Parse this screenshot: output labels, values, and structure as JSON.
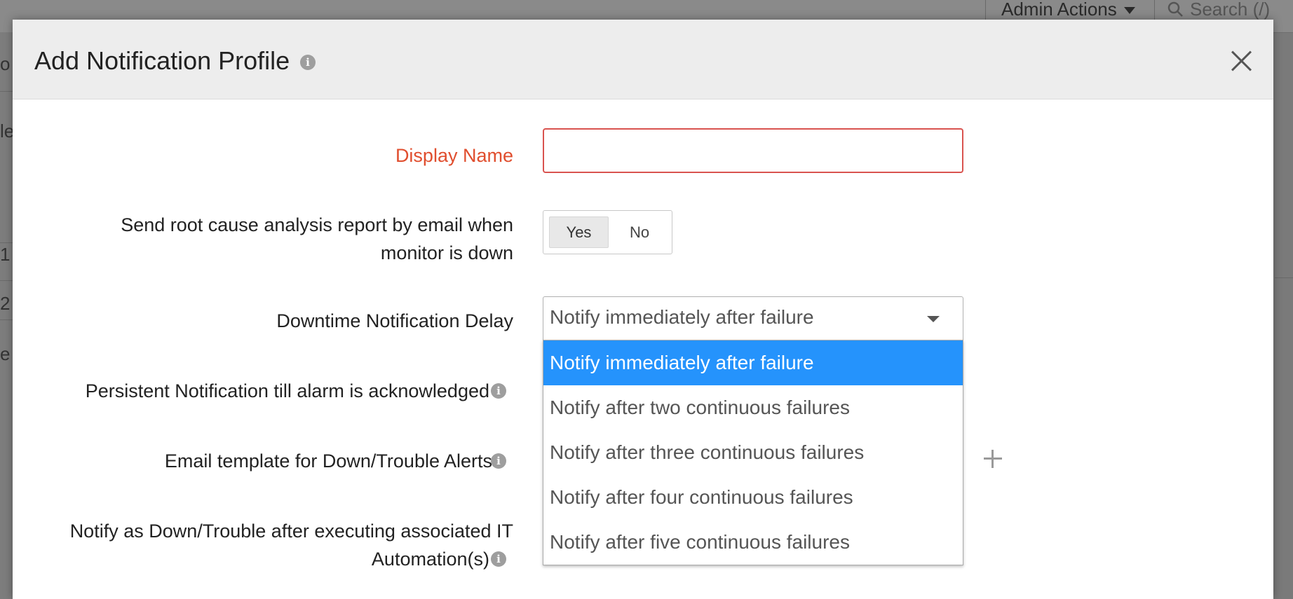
{
  "background": {
    "admin_actions": "Admin Actions",
    "search_label": "Search (/)",
    "side_fragments": [
      "o",
      "le",
      "1",
      "2",
      "e"
    ]
  },
  "modal": {
    "title": "Add Notification Profile",
    "fields": {
      "display_name": {
        "label": "Display Name",
        "value": ""
      },
      "rca_report": {
        "label_line1": "Send root cause analysis report by email when",
        "label_line2": "monitor is down",
        "yes": "Yes",
        "no": "No",
        "selected": "Yes"
      },
      "downtime_delay": {
        "label": "Downtime Notification Delay",
        "selected": "Notify immediately after failure",
        "options": [
          "Notify immediately after failure",
          "Notify after two continuous failures",
          "Notify after three continuous failures",
          "Notify after four continuous failures",
          "Notify after five continuous failures"
        ]
      },
      "persistent_notification": {
        "label": "Persistent Notification till alarm is acknowledged"
      },
      "email_template": {
        "label": "Email template for Down/Trouble Alerts"
      },
      "it_automation": {
        "label_line1": "Notify as Down/Trouble after executing associated IT",
        "label_line2": "Automation(s)"
      }
    }
  },
  "colors": {
    "required_label": "#e04e2e",
    "selected_option_bg": "#2593fc",
    "input_error_border": "#d9534f"
  }
}
